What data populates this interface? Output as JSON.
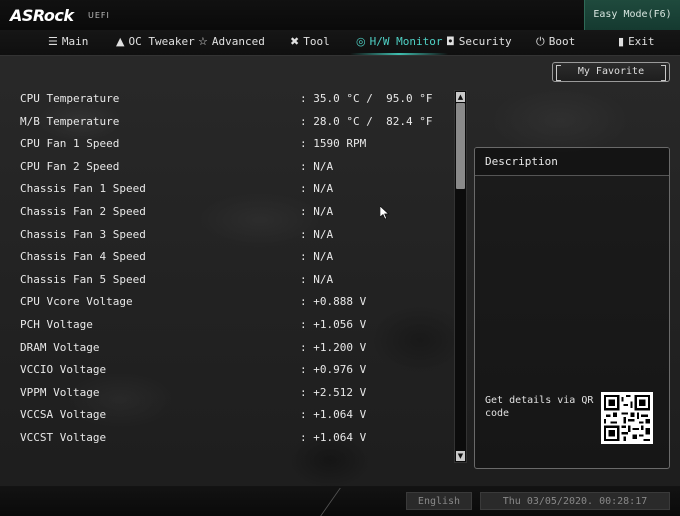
{
  "brand": {
    "name": "ASRock",
    "sub": "UEFI"
  },
  "easy_mode_label": "Easy Mode(F6)",
  "nav": [
    {
      "label": "Main",
      "icon": "list-icon",
      "glyph": "☰"
    },
    {
      "label": "OC Tweaker",
      "icon": "rocket-icon",
      "glyph": "▲"
    },
    {
      "label": "Advanced",
      "icon": "star-icon",
      "glyph": "☆"
    },
    {
      "label": "Tool",
      "icon": "tools-icon",
      "glyph": "✖"
    },
    {
      "label": "H/W Monitor",
      "icon": "monitor-icon",
      "glyph": "◎",
      "active": true
    },
    {
      "label": "Security",
      "icon": "shield-icon",
      "glyph": "◘"
    },
    {
      "label": "Boot",
      "icon": "power-icon",
      "glyph": "⏻"
    },
    {
      "label": "Exit",
      "icon": "exit-icon",
      "glyph": "▮"
    }
  ],
  "my_favorite_label": "My Favorite",
  "readings": [
    {
      "label": "CPU Temperature",
      "value": ": 35.0 °C /  95.0 °F"
    },
    {
      "label": "M/B Temperature",
      "value": ": 28.0 °C /  82.4 °F"
    },
    {
      "label": "CPU Fan 1 Speed",
      "value": ": 1590 RPM"
    },
    {
      "label": "CPU Fan 2 Speed",
      "value": ": N/A"
    },
    {
      "label": "Chassis Fan 1 Speed",
      "value": ": N/A"
    },
    {
      "label": "Chassis Fan 2 Speed",
      "value": ": N/A"
    },
    {
      "label": "Chassis Fan 3 Speed",
      "value": ": N/A"
    },
    {
      "label": "Chassis Fan 4 Speed",
      "value": ": N/A"
    },
    {
      "label": "Chassis Fan 5 Speed",
      "value": ": N/A"
    },
    {
      "label": "CPU Vcore Voltage",
      "value": ": +0.888 V"
    },
    {
      "label": "PCH Voltage",
      "value": ": +1.056 V"
    },
    {
      "label": "DRAM Voltage",
      "value": ": +1.200 V"
    },
    {
      "label": "VCCIO Voltage",
      "value": ": +0.976 V"
    },
    {
      "label": "VPPM Voltage",
      "value": ": +2.512 V"
    },
    {
      "label": "VCCSA Voltage",
      "value": ": +1.064 V"
    },
    {
      "label": "VCCST Voltage",
      "value": ": +1.064 V"
    }
  ],
  "description": {
    "title": "Description",
    "qr_text": "Get details via QR code"
  },
  "status": {
    "language": "English",
    "datetime": "Thu 03/05/2020. 00:28:17"
  },
  "colors": {
    "accent": "#4fd1c5",
    "easy_mode_bg": "#1f4a3d"
  }
}
